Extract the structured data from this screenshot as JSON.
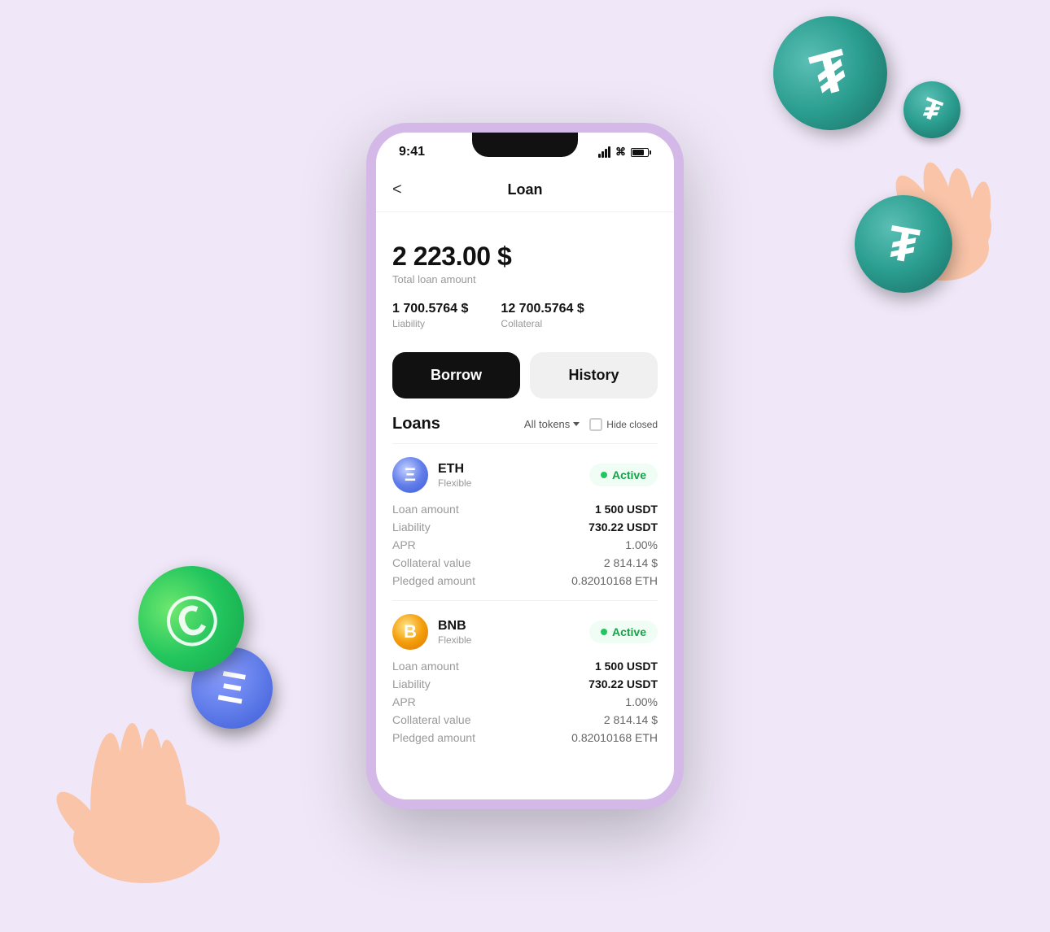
{
  "background_color": "#f0e8f8",
  "status_bar": {
    "time": "9:41",
    "signal_label": "signal",
    "wifi_label": "wifi",
    "battery_label": "battery"
  },
  "header": {
    "back_label": "<",
    "title": "Loan"
  },
  "summary": {
    "total_amount": "2 223.00 $",
    "total_label": "Total loan amount",
    "liability_value": "1 700.5764 $",
    "liability_label": "Liability",
    "collateral_value": "12 700.5764 $",
    "collateral_label": "Collateral"
  },
  "tabs": {
    "borrow_label": "Borrow",
    "history_label": "History"
  },
  "loans_section": {
    "title": "Loans",
    "filter_label": "All tokens",
    "hide_closed_label": "Hide closed"
  },
  "loan_items": [
    {
      "token": "ETH",
      "token_symbol": "Ξ",
      "type": "Flexible",
      "status": "Active",
      "loan_amount_label": "Loan amount",
      "loan_amount_value": "1 500 USDT",
      "liability_label": "Liability",
      "liability_value": "730.22 USDT",
      "apr_label": "APR",
      "apr_value": "1.00%",
      "collateral_value_label": "Collateral value",
      "collateral_value": "2 814.14 $",
      "pledged_label": "Pledged amount",
      "pledged_value": "0.82010168 ETH"
    },
    {
      "token": "BNB",
      "token_symbol": "B",
      "type": "Flexible",
      "status": "Active",
      "loan_amount_label": "Loan amount",
      "loan_amount_value": "1 500 USDT",
      "liability_label": "Liability",
      "liability_value": "730.22 USDT",
      "apr_label": "APR",
      "apr_value": "1.00%",
      "collateral_value_label": "Collateral value",
      "collateral_value": "2 814.14 $",
      "pledged_label": "Pledged amount",
      "pledged_value": "0.82010168 ETH"
    }
  ]
}
